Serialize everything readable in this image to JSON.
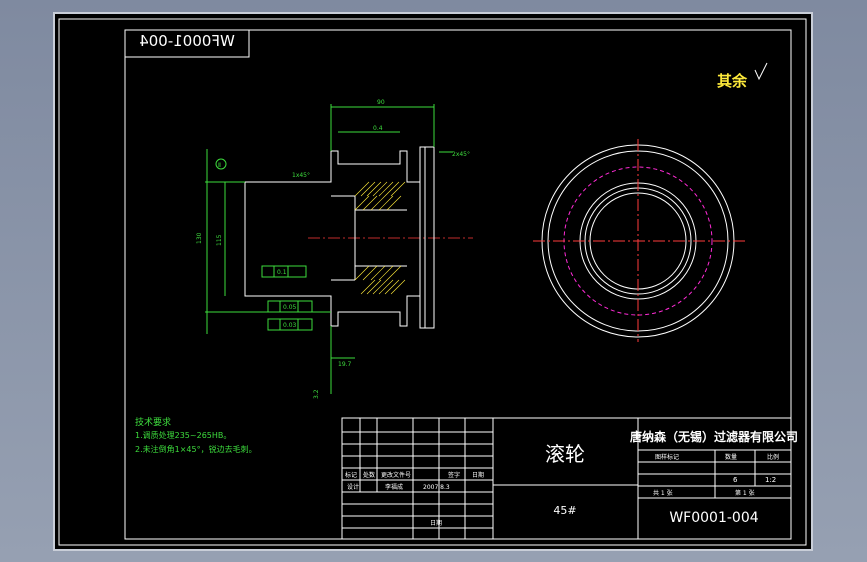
{
  "drawing": {
    "number_mirrored": "WF0001-004",
    "part_name": "滚轮",
    "material": "45#",
    "company": "唐纳森（无锡）过滤器有限公司",
    "drawing_number": "WF0001-004",
    "surface_note": "其余",
    "scale_label": "比例",
    "scale_value": "1:2",
    "count_label": "数量",
    "count_value": "6",
    "mark_label": "图样标记",
    "sheet_total": "共 1 张",
    "sheet_num": "第 1 张",
    "date_label": "日期",
    "date_value": "2007.8.3",
    "design_label": "设计",
    "design_name": "李福成",
    "header_cols": [
      "标记",
      "处数",
      "更改文件号",
      "签字",
      "日期"
    ],
    "tech_title": "技术要求",
    "tech_lines": [
      "1.调质处理235~265HB。",
      "2.未注倒角1×45°，锐边去毛刺。"
    ]
  },
  "dims": {
    "d1": "90",
    "d2": "0.4",
    "d3": "Ⅱ",
    "d4": "130",
    "d5": "115",
    "d6": "2x45°",
    "d7": "19.7",
    "d8": "3.2",
    "d9": "7",
    "d10": "0.1",
    "d11": "0.05",
    "d12": "0.03",
    "d13": "1x45°",
    "d14": "1"
  },
  "colors": {
    "border": "#ffffff",
    "dimension": "#3ddc3d",
    "centerline": "#ff3b3b",
    "hatch": "#ffeb3b",
    "hidden_circle": "#ff2bd6"
  }
}
